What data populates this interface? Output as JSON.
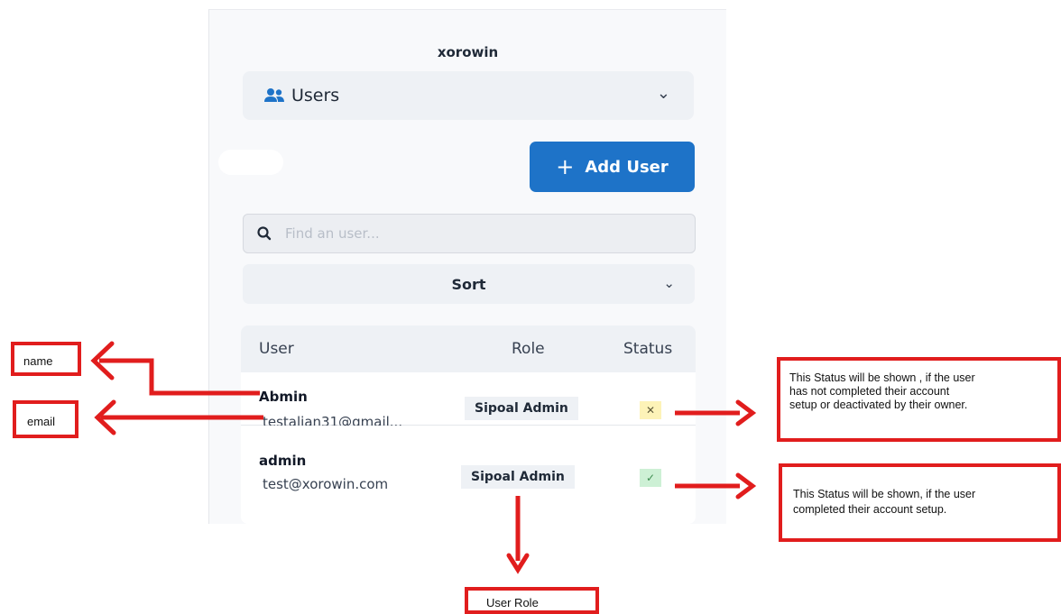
{
  "app": {
    "title": "xorowin"
  },
  "section_select": {
    "label": "Users"
  },
  "toolbar": {
    "add_user_plus": "+",
    "add_user_label": "Add User"
  },
  "search": {
    "placeholder": "Find an user..."
  },
  "sort": {
    "label": "Sort"
  },
  "table": {
    "headers": {
      "user": "User",
      "role": "Role",
      "status": "Status"
    },
    "rows": [
      {
        "name": "Abmin",
        "email": "testaljan31@gmail...",
        "role": "Sipoal Admin",
        "status_glyph": "✕",
        "status": "pending"
      },
      {
        "name": "admin",
        "email": "test@xorowin.com",
        "role": "Sipoal Admin",
        "status_glyph": "✓",
        "status": "active"
      }
    ]
  },
  "annotations": {
    "name": "name",
    "email": "email",
    "user_role": "User Role",
    "status_pending": "This Status will be shown , if the user has not completed their account setup or deactivated by their owner.",
    "status_pending_lines": [
      "This Status will be shown , if the user",
      "has not completed their account",
      "setup or deactivated by their owner."
    ],
    "status_active": "This Status will be shown, if the user completed their account setup.",
    "status_active_lines": [
      "This Status will be shown, if the user",
      "completed their account setup."
    ]
  },
  "colors": {
    "accent": "#1e73c8",
    "annotation": "#e11d1d",
    "status_pending_bg": "#fdf3b8",
    "status_active_bg": "#cdf0d5"
  },
  "icons": {
    "users": "users-icon",
    "chevron": "chevron-down-icon",
    "search": "search-icon",
    "plus": "plus-icon",
    "pending": "x-icon",
    "active": "check-icon"
  }
}
